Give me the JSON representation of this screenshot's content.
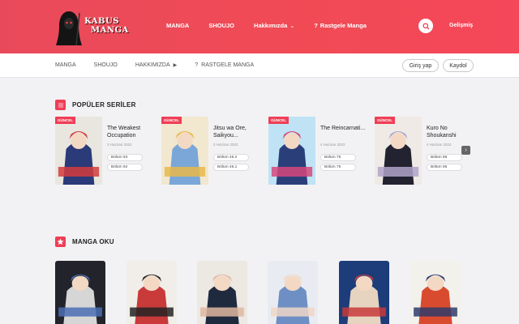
{
  "header": {
    "logo_line1": "KABUS",
    "logo_line2": "MANGA",
    "nav": [
      {
        "label": "MANGA",
        "chevron": false,
        "prefix": ""
      },
      {
        "label": "SHOUJO",
        "chevron": false,
        "prefix": ""
      },
      {
        "label": "Hakkımızda",
        "chevron": true,
        "prefix": ""
      },
      {
        "label": "Rastgele Manga",
        "chevron": false,
        "prefix": "?"
      }
    ],
    "mode_link": "Gelişmiş"
  },
  "subnav": {
    "links": [
      {
        "label": "MANGA",
        "prefix": "",
        "suffix": ""
      },
      {
        "label": "SHOUJO",
        "prefix": "",
        "suffix": ""
      },
      {
        "label": "HAKKIMIZDA",
        "prefix": "",
        "suffix": "▶"
      },
      {
        "label": "RASTGELE MANGA",
        "prefix": "?",
        "suffix": ""
      }
    ],
    "login": "Giriş yap",
    "register": "Kaydol"
  },
  "popular": {
    "title": "POPÜLER SERİLER",
    "cards": [
      {
        "badge": "GÜNCEL",
        "title": "The Weakest Occupation",
        "date": "3 Haziran 2022",
        "chapters": [
          "Bölüm 93",
          "Bölüm 92"
        ],
        "colors": [
          "#e8e6df",
          "#2b3a78",
          "#d33c3c"
        ]
      },
      {
        "badge": "GÜNCEL",
        "title": "Jitsu wa Ore, Saikyou...",
        "date": "3 Haziran 2022",
        "chapters": [
          "Bölüm 46.2",
          "Bölüm 46.1"
        ],
        "colors": [
          "#f2e7cf",
          "#7aa7d8",
          "#e8b84a"
        ]
      },
      {
        "badge": "GÜNCEL",
        "title": "The Reincarnati...",
        "date": "4 Haziran 2022",
        "chapters": [
          "Bölüm 76",
          "Bölüm 75"
        ],
        "colors": [
          "#bfe3f5",
          "#2a3f7a",
          "#d6487c"
        ]
      },
      {
        "badge": "GÜNCEL",
        "title": "Kuro No Shoukanshi",
        "date": "4 Haziran 2022",
        "chapters": [
          "Bölüm 96",
          "Bölüm 95"
        ],
        "colors": [
          "#efeae6",
          "#222230",
          "#b0a3c9"
        ]
      }
    ]
  },
  "manga_oku": {
    "title": "MANGA OKU",
    "covers": [
      {
        "colors": [
          "#22232b",
          "#d6d6d6",
          "#4a6fb4"
        ]
      },
      {
        "colors": [
          "#f1eee9",
          "#c93a3a",
          "#232323"
        ]
      },
      {
        "colors": [
          "#ece8e2",
          "#1f2a3f",
          "#e0b7a0"
        ]
      },
      {
        "colors": [
          "#e8ecf2",
          "#6d8fc4",
          "#f0d7c8"
        ]
      },
      {
        "colors": [
          "#1c3c7a",
          "#e6d4c0",
          "#c83a3a"
        ]
      },
      {
        "colors": [
          "#f3f1ec",
          "#d94b2f",
          "#2f3b6a"
        ]
      },
      {
        "colors": [
          "#eef3d7",
          "#7fb04a",
          "#e3c94c"
        ]
      }
    ]
  },
  "icons": {
    "search": "search-icon",
    "prev": "chevron-left-icon",
    "next": "chevron-right-icon",
    "section_popular": "square-icon",
    "section_manga": "star-icon"
  },
  "colors": {
    "accent": "#ef3e55"
  }
}
